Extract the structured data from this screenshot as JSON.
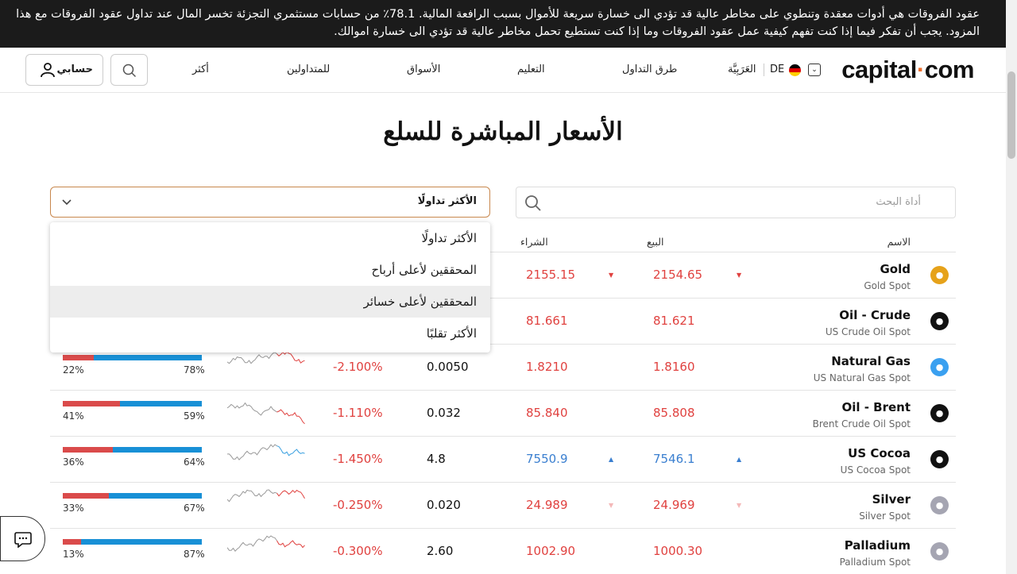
{
  "banner": {
    "text": "عقود الفروقات هي أدوات معقدة وتنطوي على مخاطر عالية قد تؤدي الى خسارة سريعة للأموال بسبب الرافعة المالية. 78.1٪ من حسابات مستثمري التجزئة تخسر المال عند تداول عقود الفروقات مع هذا المزود. يجب أن تفكر فيما إذا كنت تفهم كيفية عمل عقود الفروقات وما إذا كنت تستطيع تحمل مخاطر عالية قد تؤدي الى خسارة اموالك."
  },
  "nav": {
    "logo_a": "capital",
    "logo_b": "com",
    "lang": "DE",
    "language": "العَرَبِيَّة",
    "items": [
      "طرق التداول",
      "التعليم",
      "الأسواق",
      "للمتداولين",
      "أكثر"
    ],
    "account": "حسابي"
  },
  "page": {
    "title": "الأسعار المباشرة للسلع",
    "search_placeholder": "أداة البحث",
    "select_value": "الأكثر تداولًا"
  },
  "dropdown": {
    "options": [
      "الأكثر تداولًا",
      "المحققين لأعلى أرباح",
      "المحققين لأعلى خسائر",
      "الأكثر تقلبًا"
    ],
    "highlighted": 2
  },
  "headers": {
    "name": "الاسم",
    "sell": "البيع",
    "buy": "الشراء"
  },
  "colors": {
    "red": "#e0413f",
    "blue": "#3a7fd0",
    "sent_red": "#da4b4b",
    "sent_blue": "#1890d6"
  },
  "rows": [
    {
      "name": "Gold",
      "sub": "Gold Spot",
      "sell": "2154.65",
      "buy": "2155.15",
      "change": "",
      "pct": "",
      "dir": "down",
      "icon": "gold-icon",
      "icon_color": "#e6a21a",
      "sent_sell": null,
      "sent_buy": null,
      "sell_label": "",
      "buy_label": ""
    },
    {
      "name": "Oil - Crude",
      "sub": "US Crude Oil Spot",
      "sell": "81.621",
      "buy": "81.661",
      "change": "",
      "pct": "",
      "dir": "down-none",
      "icon": "oil-drop-icon",
      "icon_color": "#111111",
      "sent_sell": null,
      "sent_buy": null,
      "sell_label": "",
      "buy_label": ""
    },
    {
      "name": "Natural Gas",
      "sub": "US Natural Gas Spot",
      "sell": "1.8160",
      "buy": "1.8210",
      "change": "0.0050",
      "pct": "-2.100%",
      "dir": "down-none",
      "icon": "flame-icon",
      "icon_color": "#3aa0f0",
      "sent_sell": 22,
      "sent_buy": 78,
      "sell_label": "22%",
      "buy_label": "78%"
    },
    {
      "name": "Oil - Brent",
      "sub": "Brent Crude Oil Spot",
      "sell": "85.808",
      "buy": "85.840",
      "change": "0.032",
      "pct": "-1.110%",
      "dir": "down-none",
      "icon": "barrel-icon",
      "icon_color": "#111111",
      "sent_sell": 41,
      "sent_buy": 59,
      "sell_label": "41%",
      "buy_label": "59%"
    },
    {
      "name": "US Cocoa",
      "sub": "US Cocoa Spot",
      "sell": "7546.1",
      "buy": "7550.9",
      "change": "4.8",
      "pct": "-1.450%",
      "dir": "up",
      "icon": "cocoa-icon",
      "icon_color": "#111111",
      "sent_sell": 36,
      "sent_buy": 64,
      "sell_label": "36%",
      "buy_label": "64%"
    },
    {
      "name": "Silver",
      "sub": "Silver Spot",
      "sell": "24.969",
      "buy": "24.989",
      "change": "0.020",
      "pct": "-0.250%",
      "dir": "down-faint",
      "icon": "silver-icon",
      "icon_color": "#a5a5b2",
      "sent_sell": 33,
      "sent_buy": 67,
      "sell_label": "33%",
      "buy_label": "67%"
    },
    {
      "name": "Palladium",
      "sub": "Palladium Spot",
      "sell": "1000.30",
      "buy": "1002.90",
      "change": "2.60",
      "pct": "-0.300%",
      "dir": "none",
      "icon": "palladium-icon",
      "icon_color": "#a5a5b2",
      "sent_sell": 13,
      "sent_buy": 87,
      "sell_label": "13%",
      "buy_label": "87%"
    }
  ]
}
